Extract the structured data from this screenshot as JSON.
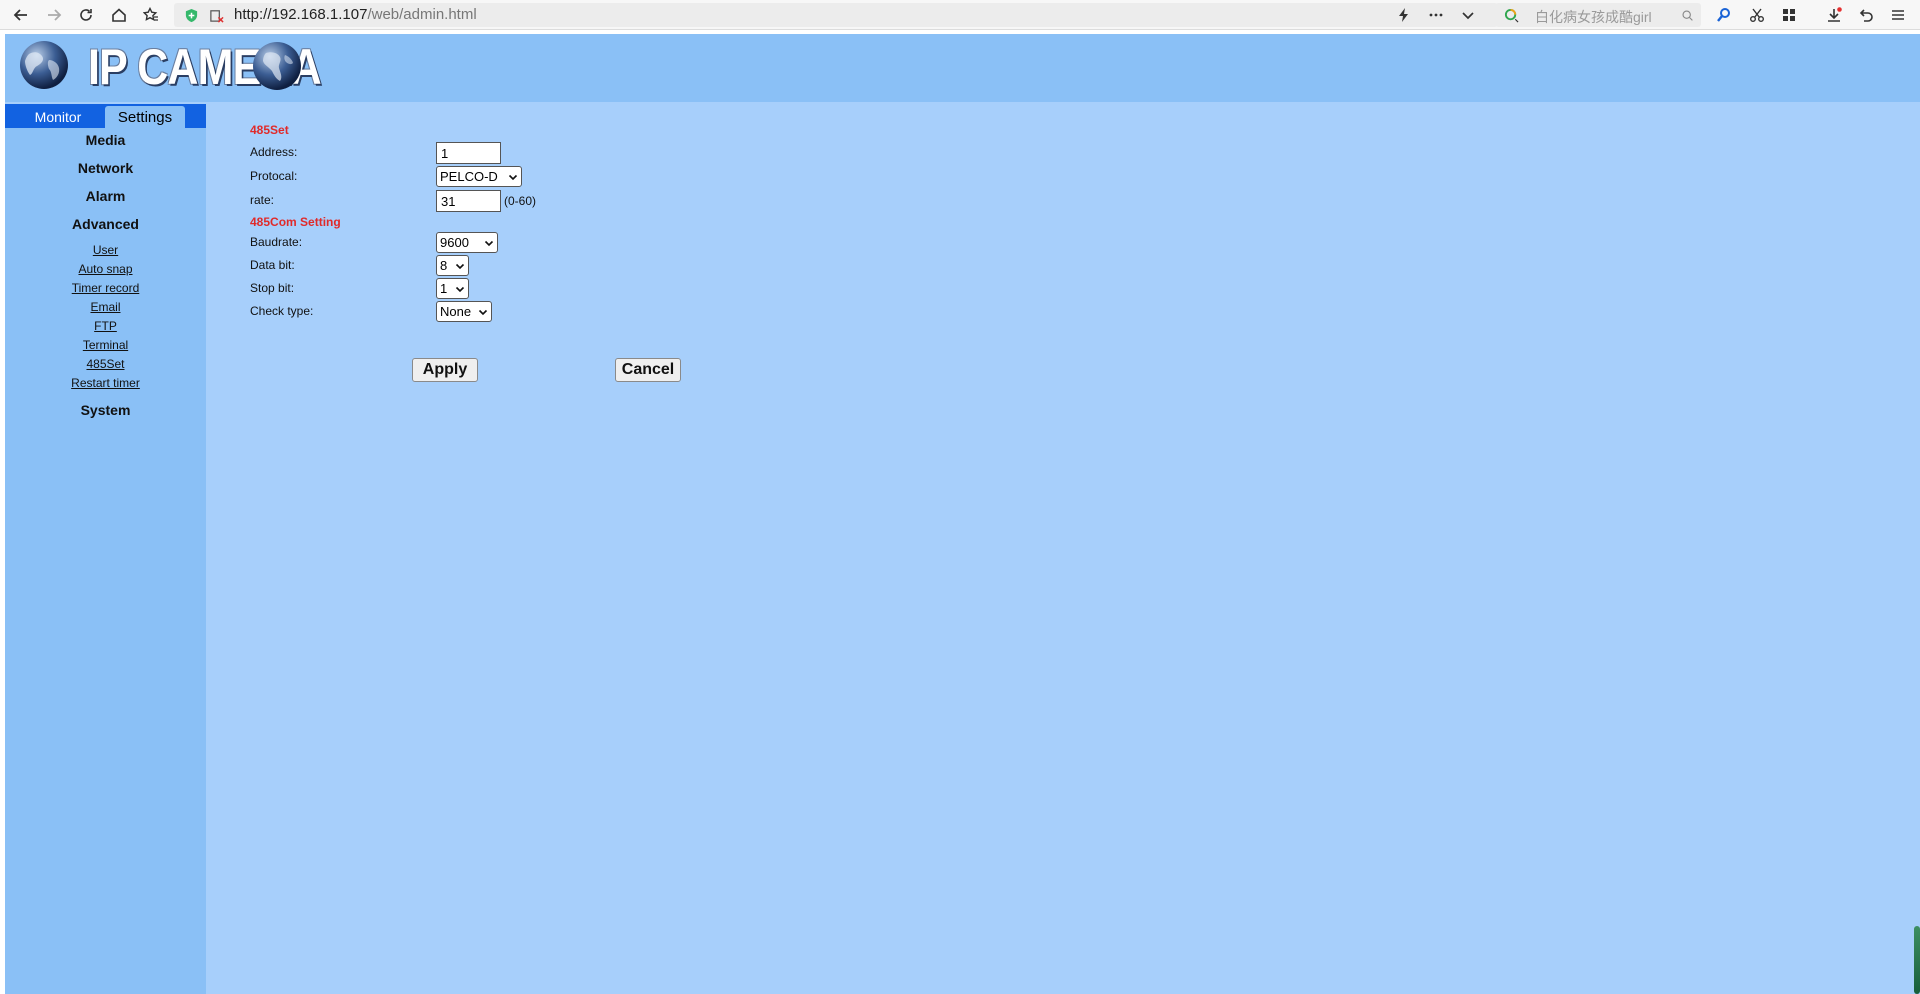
{
  "browser": {
    "url_scheme_host": "http://192.168.1.107",
    "url_path": "/web/admin.html",
    "search_placeholder": "白化病女孩成酷girl"
  },
  "header": {
    "title": "IP CAMERA"
  },
  "tabs": {
    "monitor": "Monitor",
    "settings": "Settings"
  },
  "menu": {
    "media": "Media",
    "network": "Network",
    "alarm": "Alarm",
    "advanced": "Advanced",
    "advanced_items": [
      "User",
      "Auto snap",
      "Timer record",
      "Email",
      "FTP",
      "Terminal",
      "485Set",
      "Restart timer"
    ],
    "system": "System"
  },
  "form": {
    "section_485set": "485Set",
    "address_label": "Address:",
    "address_value": "1",
    "protocol_label": "Protocal:",
    "protocol_value": "PELCO-D",
    "rate_label": "rate:",
    "rate_value": "31",
    "rate_hint": "(0-60)",
    "section_com": "485Com Setting",
    "baudrate_label": "Baudrate:",
    "baudrate_value": "9600",
    "databit_label": "Data bit:",
    "databit_value": "8",
    "stopbit_label": "Stop bit:",
    "stopbit_value": "1",
    "checktype_label": "Check type:",
    "checktype_value": "None",
    "apply_label": "Apply",
    "cancel_label": "Cancel"
  },
  "colors": {
    "page_bg": "#a7cffb",
    "sidebar_bg": "#8ac0f6",
    "tab_strip": "#1262e1",
    "section_title": "#e02a2a"
  }
}
